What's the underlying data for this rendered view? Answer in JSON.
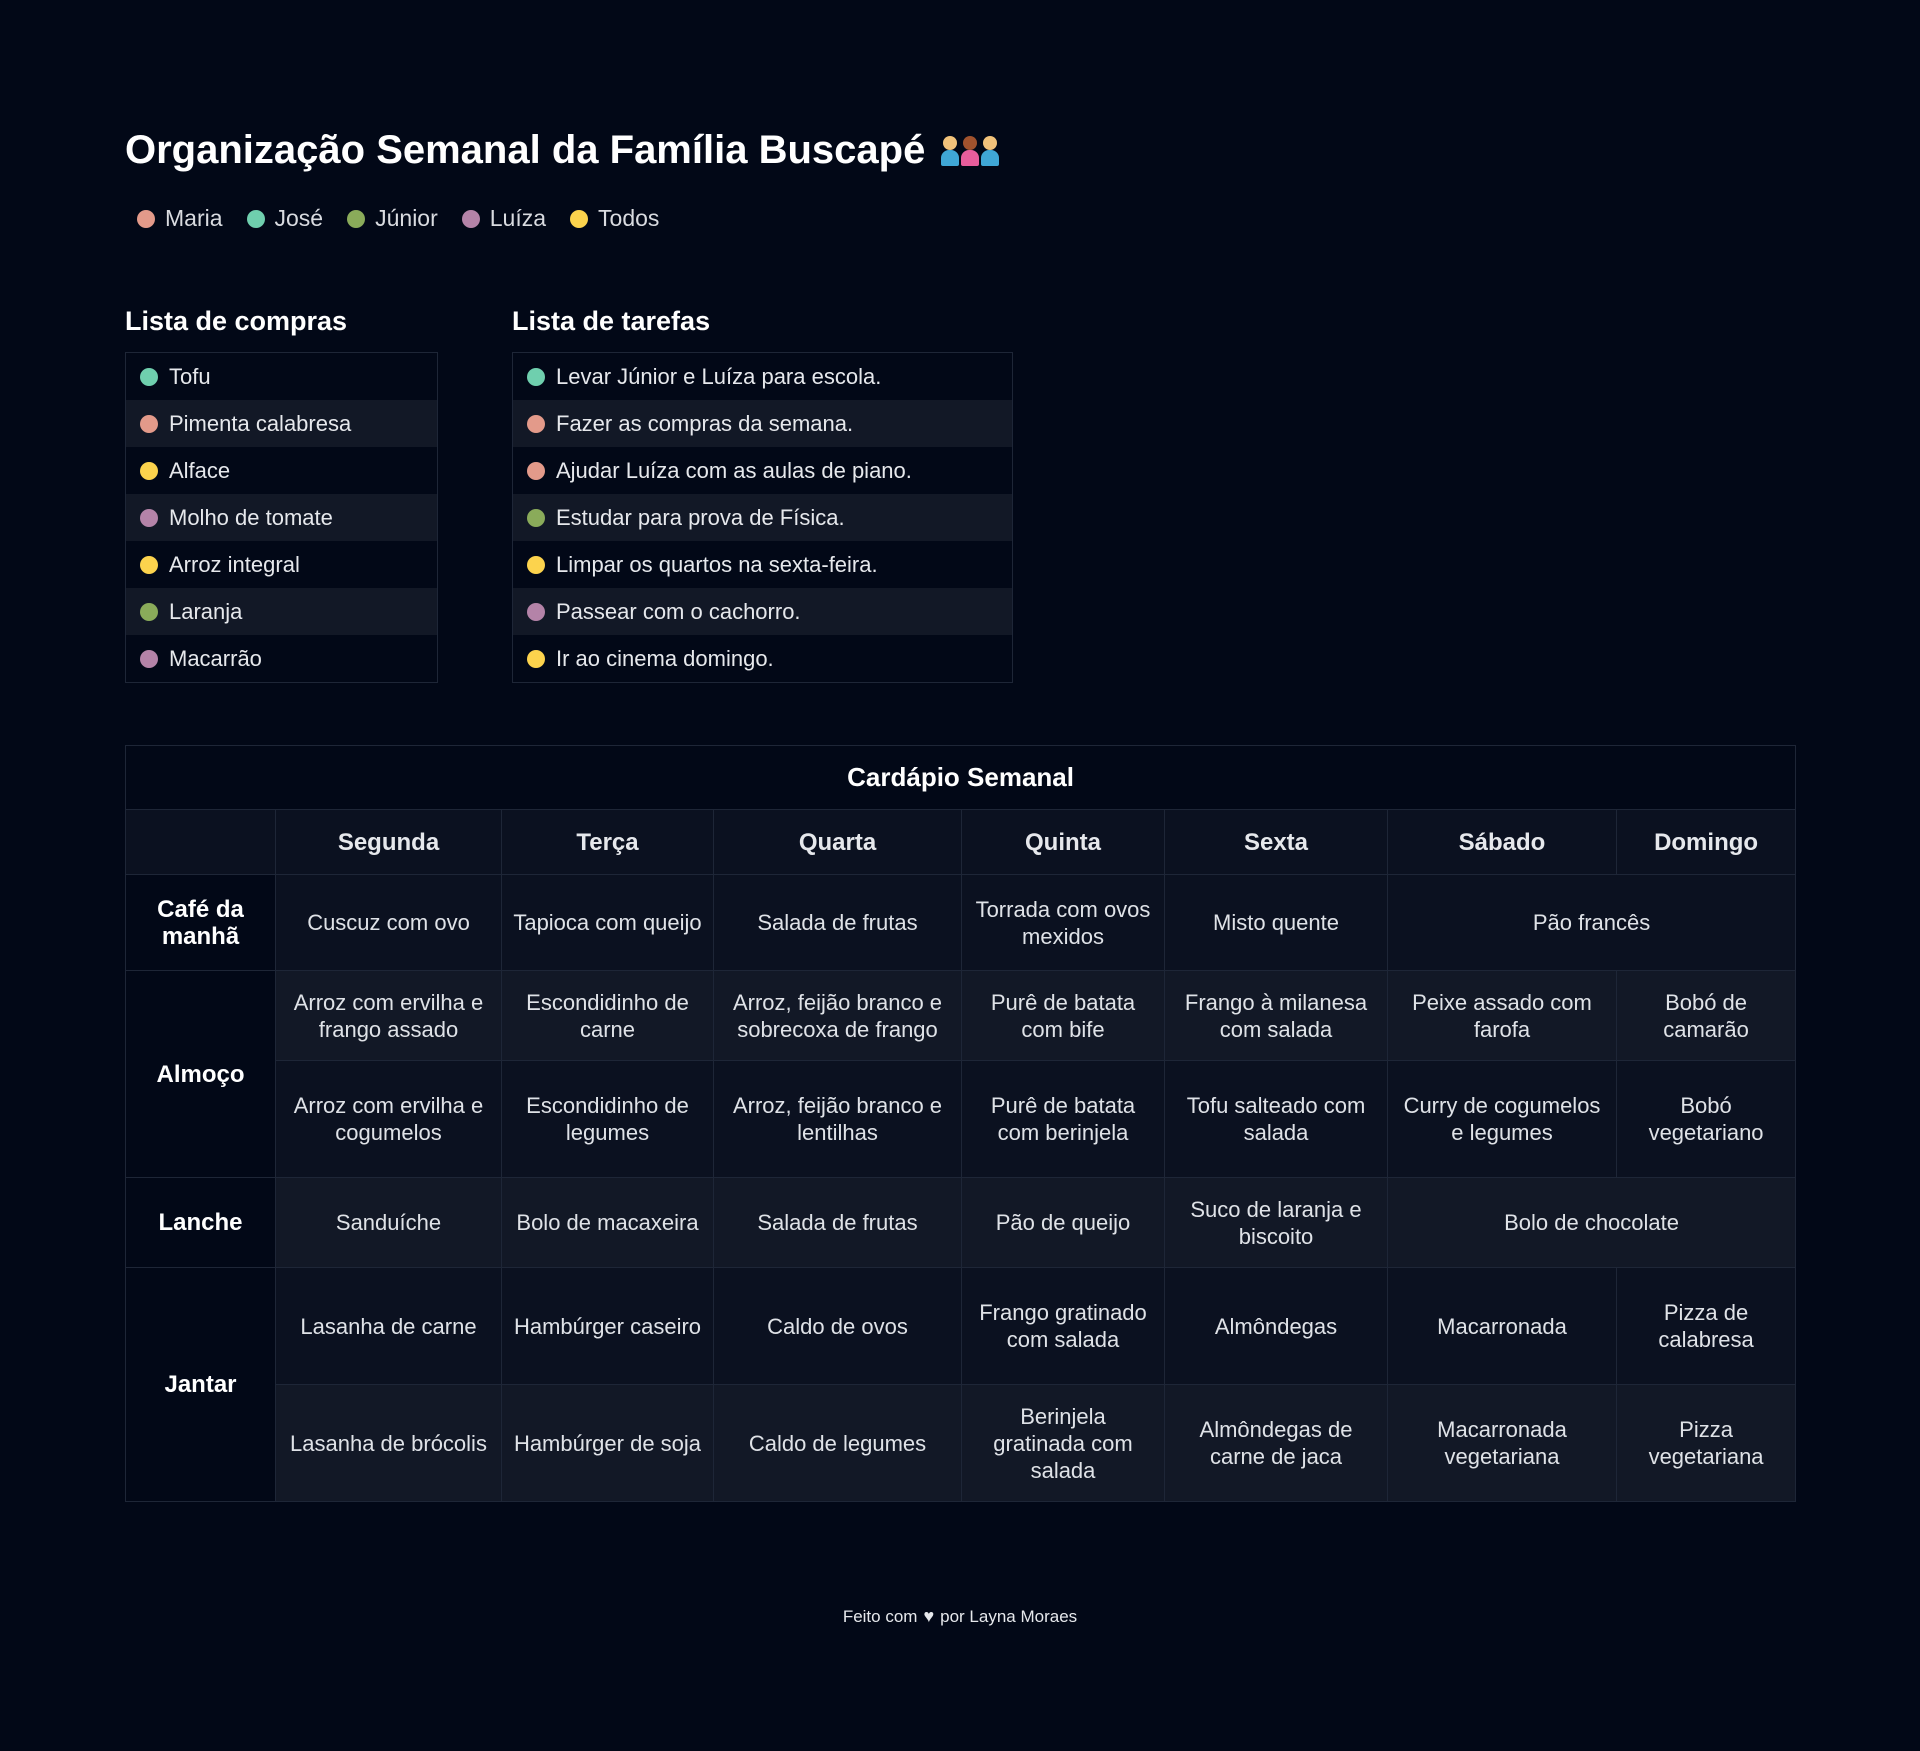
{
  "title": "Organização Semanal da Família Buscapé",
  "title_icon": "family-icon",
  "legend": [
    {
      "name": "Maria",
      "color": "#e39a8a"
    },
    {
      "name": "José",
      "color": "#6fcfae"
    },
    {
      "name": "Júnior",
      "color": "#8aab5a"
    },
    {
      "name": "Luíza",
      "color": "#b483a8"
    },
    {
      "name": "Todos",
      "color": "#fcd34d"
    }
  ],
  "shopping": {
    "title": "Lista de compras",
    "items": [
      {
        "text": "Tofu",
        "color": "#6fcfae"
      },
      {
        "text": "Pimenta calabresa",
        "color": "#e39a8a"
      },
      {
        "text": "Alface",
        "color": "#fcd34d"
      },
      {
        "text": "Molho de tomate",
        "color": "#b483a8"
      },
      {
        "text": "Arroz integral",
        "color": "#fcd34d"
      },
      {
        "text": "Laranja",
        "color": "#8aab5a"
      },
      {
        "text": "Macarrão",
        "color": "#b483a8"
      }
    ]
  },
  "tasks": {
    "title": "Lista de tarefas",
    "items": [
      {
        "text": "Levar Júnior e Luíza para escola.",
        "color": "#6fcfae"
      },
      {
        "text": "Fazer as compras da semana.",
        "color": "#e39a8a"
      },
      {
        "text": "Ajudar Luíza com as aulas de piano.",
        "color": "#e39a8a"
      },
      {
        "text": "Estudar para prova de Física.",
        "color": "#8aab5a"
      },
      {
        "text": "Limpar os quartos na sexta-feira.",
        "color": "#fcd34d"
      },
      {
        "text": "Passear com o cachorro.",
        "color": "#b483a8"
      },
      {
        "text": "Ir ao cinema domingo.",
        "color": "#fcd34d"
      }
    ]
  },
  "menu": {
    "title": "Cardápio Semanal",
    "days": [
      "Segunda",
      "Terça",
      "Quarta",
      "Quinta",
      "Sexta",
      "Sábado",
      "Domingo"
    ],
    "breakfast": {
      "label": "Café da manhã",
      "items": [
        "Cuscuz com ovo",
        "Tapioca com queijo",
        "Salada de frutas",
        "Torrada com ovos mexidos",
        "Misto quente",
        "Pão francês"
      ]
    },
    "lunch": {
      "label": "Almoço",
      "row1": [
        "Arroz com ervilha e frango assado",
        "Escondidinho de carne",
        "Arroz, feijão branco e sobrecoxa de frango",
        "Purê de batata com bife",
        "Frango à milanesa com salada",
        "Peixe assado com farofa",
        "Bobó de camarão"
      ],
      "row2": [
        "Arroz com ervilha e cogumelos",
        "Escondidinho de legumes",
        "Arroz, feijão branco e lentilhas",
        "Purê de batata com berinjela",
        "Tofu salteado com salada",
        "Curry de cogumelos e legumes",
        "Bobó vegetariano"
      ]
    },
    "snack": {
      "label": "Lanche",
      "items": [
        "Sanduíche",
        "Bolo de macaxeira",
        "Salada de frutas",
        "Pão de queijo",
        "Suco de laranja e biscoito",
        "Bolo de chocolate"
      ]
    },
    "dinner": {
      "label": "Jantar",
      "row1": [
        "Lasanha de carne",
        "Hambúrger caseiro",
        "Caldo de ovos",
        "Frango gratinado com salada",
        "Almôndegas",
        "Macarronada",
        "Pizza de calabresa"
      ],
      "row2": [
        "Lasanha de brócolis",
        "Hambúrger de soja",
        "Caldo de legumes",
        "Berinjela gratinada com salada",
        "Almôndegas de carne de jaca",
        "Macarronada vegetariana",
        "Pizza vegetariana"
      ]
    }
  },
  "footer": {
    "before": "Feito com",
    "icon": "heart-icon",
    "after": "por Layna Moraes"
  }
}
